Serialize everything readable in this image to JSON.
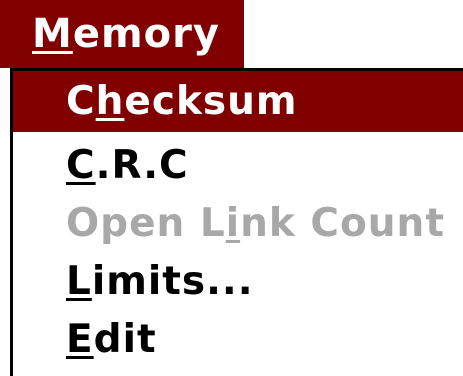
{
  "menubar": {
    "memory": {
      "mnemonic": "M",
      "rest": "emory"
    }
  },
  "menu": {
    "items": [
      {
        "pre": "C",
        "mnemonic": "h",
        "post": "ecksum",
        "state": "selected"
      },
      {
        "pre": "",
        "mnemonic": "C",
        "post": ".R.C",
        "state": "enabled"
      },
      {
        "pre": "Open L",
        "mnemonic": "i",
        "post": "nk Count",
        "state": "disabled"
      },
      {
        "pre": "",
        "mnemonic": "L",
        "post": "imits...",
        "state": "enabled"
      },
      {
        "pre": "",
        "mnemonic": "E",
        "post": "dit",
        "state": "enabled"
      }
    ]
  },
  "colors": {
    "highlight": "#800000",
    "highlight_text": "#ffffff",
    "disabled_text": "#a8a8a8"
  }
}
